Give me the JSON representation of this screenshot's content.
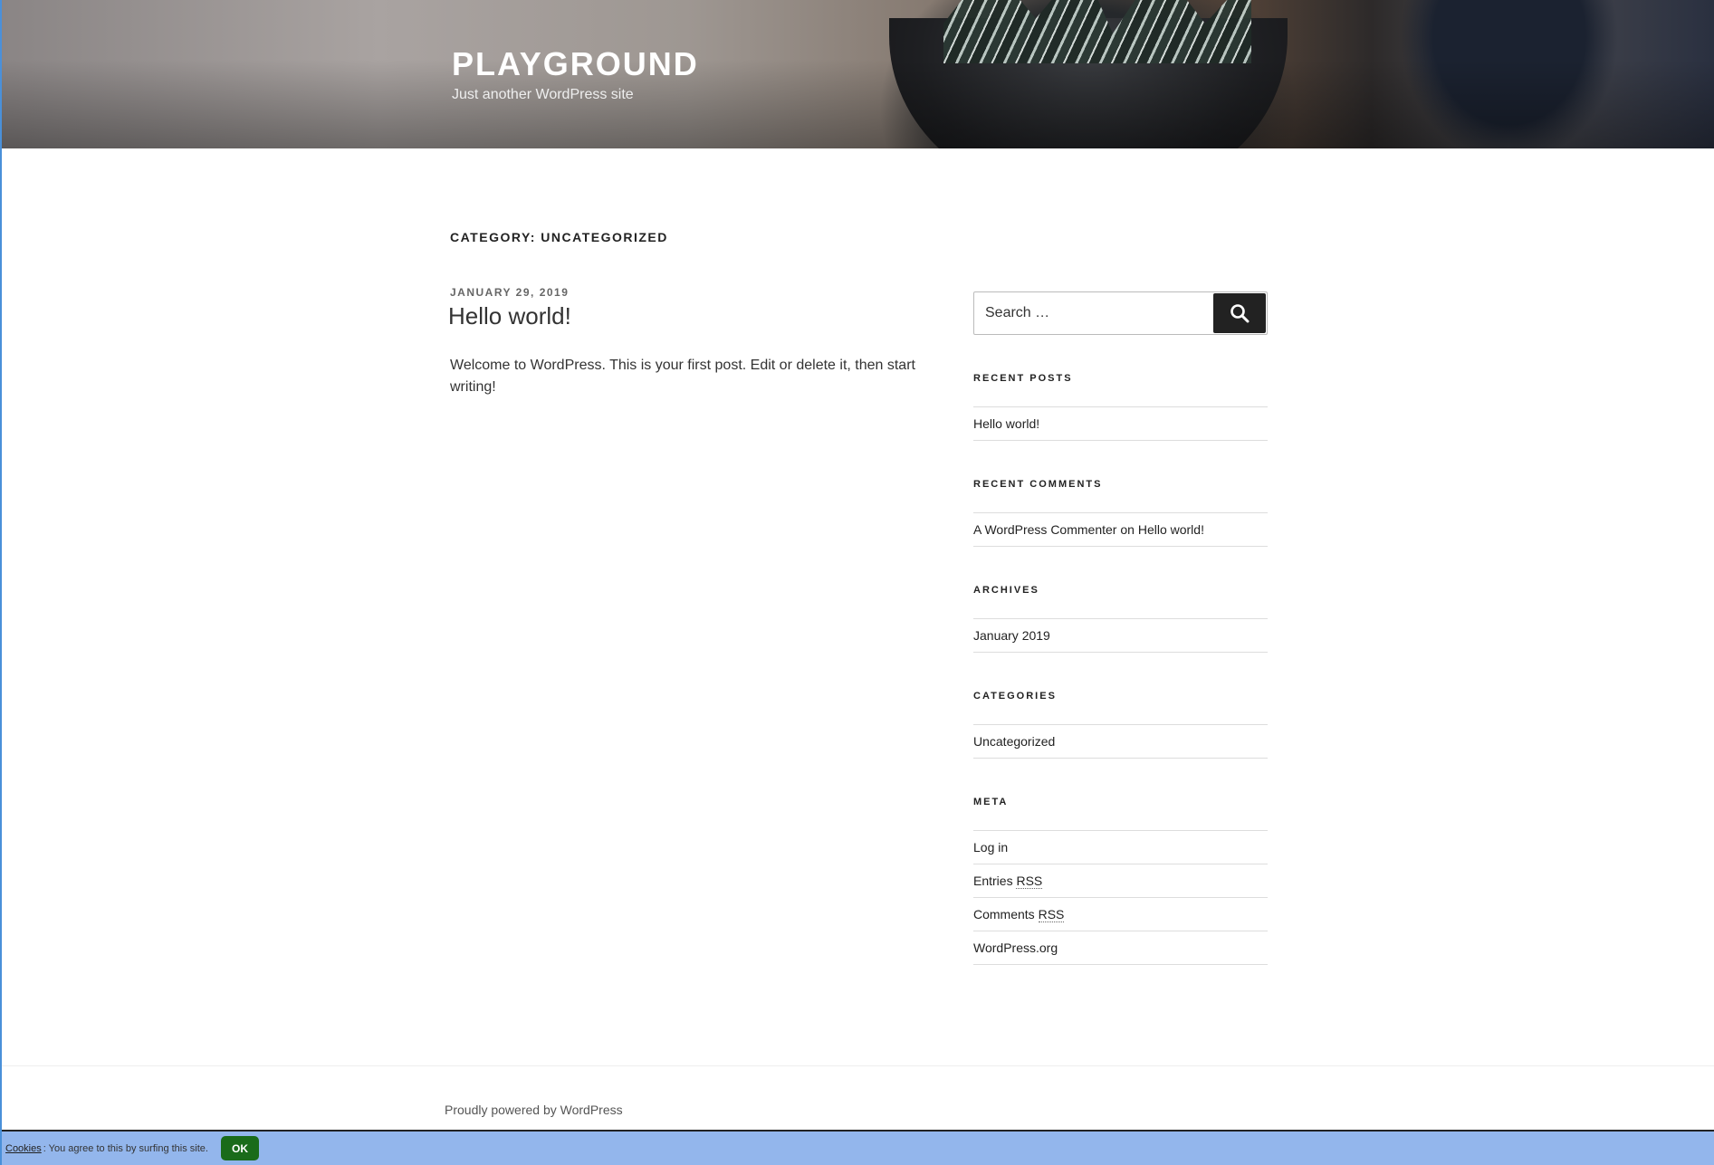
{
  "header": {
    "site_title": "PLAYGROUND",
    "site_description": "Just another WordPress site"
  },
  "archive": {
    "title": "CATEGORY: UNCATEGORIZED"
  },
  "post": {
    "date": "JANUARY 29, 2019",
    "title": "Hello world!",
    "excerpt": "Welcome to WordPress. This is your first post. Edit or delete it, then start writing!"
  },
  "sidebar": {
    "search": {
      "placeholder": "Search …",
      "button_icon": "search-icon"
    },
    "recent_posts": {
      "title": "RECENT POSTS",
      "items": [
        "Hello world!"
      ]
    },
    "recent_comments": {
      "title": "RECENT COMMENTS",
      "items": [
        {
          "author": "A WordPress Commenter",
          "connector": "on",
          "post": "Hello world!"
        }
      ]
    },
    "archives": {
      "title": "ARCHIVES",
      "items": [
        "January 2019"
      ]
    },
    "categories": {
      "title": "CATEGORIES",
      "items": [
        "Uncategorized"
      ]
    },
    "meta": {
      "title": "META",
      "items": [
        {
          "text": "Log in"
        },
        {
          "text": "Entries ",
          "abbr": "RSS"
        },
        {
          "text": "Comments ",
          "abbr": "RSS"
        },
        {
          "text": "WordPress.org"
        }
      ]
    }
  },
  "footer": {
    "credit": "Proudly powered by WordPress"
  },
  "cookie_bar": {
    "link": "Cookies",
    "text": ": You agree to this by surfing this site.",
    "ok_label": "OK",
    "background": "#93b6ec",
    "button_color": "#1a6b1a"
  }
}
